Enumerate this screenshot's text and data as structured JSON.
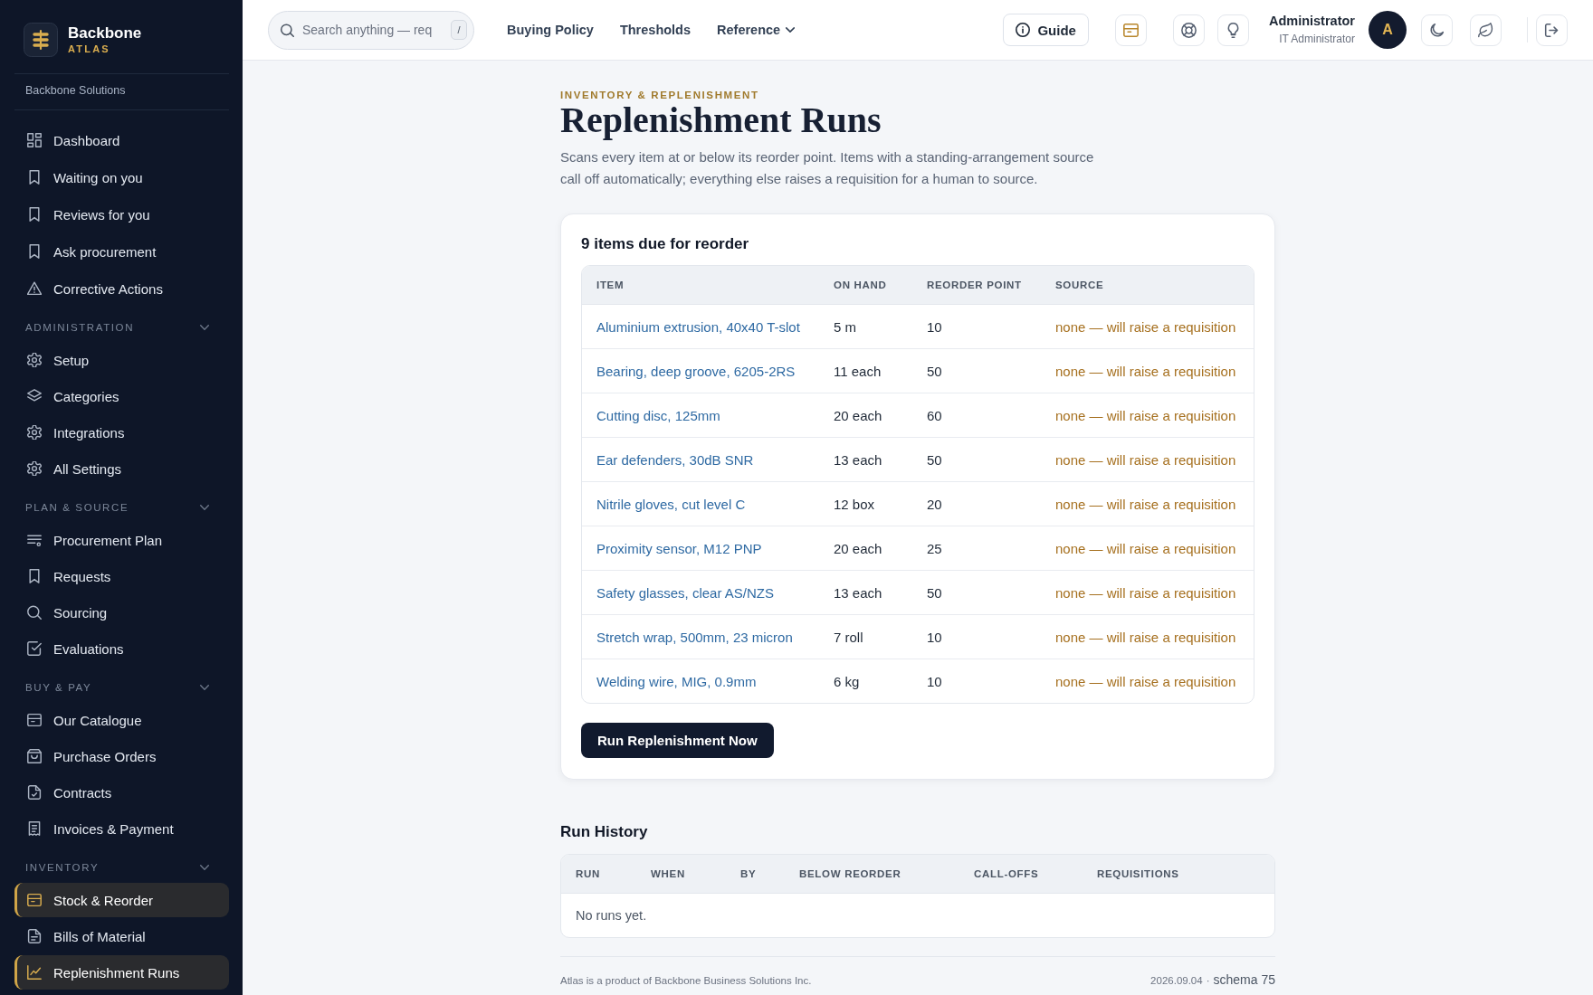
{
  "sidebar": {
    "brand": {
      "name": "Backbone",
      "product": "ATLAS"
    },
    "organization": "Backbone Solutions",
    "sections": [
      {
        "items": [
          {
            "label": "Dashboard",
            "selected": false
          },
          {
            "label": "Waiting on you",
            "selected": false
          },
          {
            "label": "Reviews for you",
            "selected": false
          },
          {
            "label": "Ask procurement",
            "selected": false
          },
          {
            "label": "Corrective Actions",
            "selected": false
          }
        ]
      },
      {
        "title": "ADMINISTRATION",
        "expanded": true,
        "items": [
          {
            "label": "Setup",
            "selected": false
          },
          {
            "label": "Categories",
            "selected": false
          },
          {
            "label": "Integrations",
            "selected": false
          },
          {
            "label": "All Settings",
            "selected": false
          }
        ]
      },
      {
        "title": "PLAN & SOURCE",
        "expanded": true,
        "items": [
          {
            "label": "Procurement Plan",
            "selected": false
          },
          {
            "label": "Requests",
            "selected": false
          },
          {
            "label": "Sourcing",
            "selected": false
          },
          {
            "label": "Evaluations",
            "selected": false
          }
        ]
      },
      {
        "title": "BUY & PAY",
        "expanded": true,
        "items": [
          {
            "label": "Our Catalogue",
            "selected": false
          },
          {
            "label": "Purchase Orders",
            "selected": false
          },
          {
            "label": "Contracts",
            "selected": false
          },
          {
            "label": "Invoices & Payment",
            "selected": false
          }
        ]
      },
      {
        "title": "INVENTORY",
        "expanded": true,
        "items": [
          {
            "label": "Stock & Reorder",
            "selected": true
          },
          {
            "label": "Bills of Material",
            "selected": false
          },
          {
            "label": "Replenishment Runs",
            "selected": true
          }
        ]
      }
    ]
  },
  "top_bar": {
    "search": {
      "placeholder": "Search anything — req",
      "shortcut": "/"
    },
    "links": [
      {
        "label": "Buying Policy",
        "kind": "link"
      },
      {
        "label": "Thresholds",
        "kind": "link"
      },
      {
        "label": "Reference",
        "kind": "menu"
      }
    ],
    "guide_button": "Guide",
    "user": {
      "name": "Administrator",
      "role": "IT Administrator",
      "initial": "A"
    }
  },
  "page": {
    "eyebrow": "INVENTORY & REPLENISHMENT",
    "title": "Replenishment Runs",
    "description": "Scans every item at or below its reorder point. Items with a standing-arrangement source call off automatically; everything else raises a requisition for a human to source."
  },
  "reorder_card": {
    "title": "9 items due for reorder",
    "columns": [
      "ITEM",
      "ON HAND",
      "REORDER POINT",
      "SOURCE"
    ],
    "rows": [
      {
        "item": "Aluminium extrusion, 40x40 T-slot",
        "on_hand": "5 m",
        "reorder_point": "10",
        "source": "none — will raise a requisition"
      },
      {
        "item": "Bearing, deep groove, 6205-2RS",
        "on_hand": "11 each",
        "reorder_point": "50",
        "source": "none — will raise a requisition"
      },
      {
        "item": "Cutting disc, 125mm",
        "on_hand": "20 each",
        "reorder_point": "60",
        "source": "none — will raise a requisition"
      },
      {
        "item": "Ear defenders, 30dB SNR",
        "on_hand": "13 each",
        "reorder_point": "50",
        "source": "none — will raise a requisition"
      },
      {
        "item": "Nitrile gloves, cut level C",
        "on_hand": "12 box",
        "reorder_point": "20",
        "source": "none — will raise a requisition"
      },
      {
        "item": "Proximity sensor, M12 PNP",
        "on_hand": "20 each",
        "reorder_point": "25",
        "source": "none — will raise a requisition"
      },
      {
        "item": "Safety glasses, clear AS/NZS",
        "on_hand": "13 each",
        "reorder_point": "50",
        "source": "none — will raise a requisition"
      },
      {
        "item": "Stretch wrap, 500mm, 23 micron",
        "on_hand": "7 roll",
        "reorder_point": "10",
        "source": "none — will raise a requisition"
      },
      {
        "item": "Welding wire, MIG, 0.9mm",
        "on_hand": "6 kg",
        "reorder_point": "10",
        "source": "none — will raise a requisition"
      }
    ],
    "button": "Run Replenishment Now"
  },
  "run_history": {
    "title": "Run History",
    "columns": [
      "RUN",
      "WHEN",
      "BY",
      "BELOW REORDER",
      "CALL-OFFS",
      "REQUISITIONS"
    ],
    "empty_text": "No runs yet."
  },
  "footer": {
    "credit": "Atlas is a product of Backbone Business Solutions Inc.",
    "date": "2026.09.04",
    "separator": "·",
    "schema": "schema 75"
  }
}
